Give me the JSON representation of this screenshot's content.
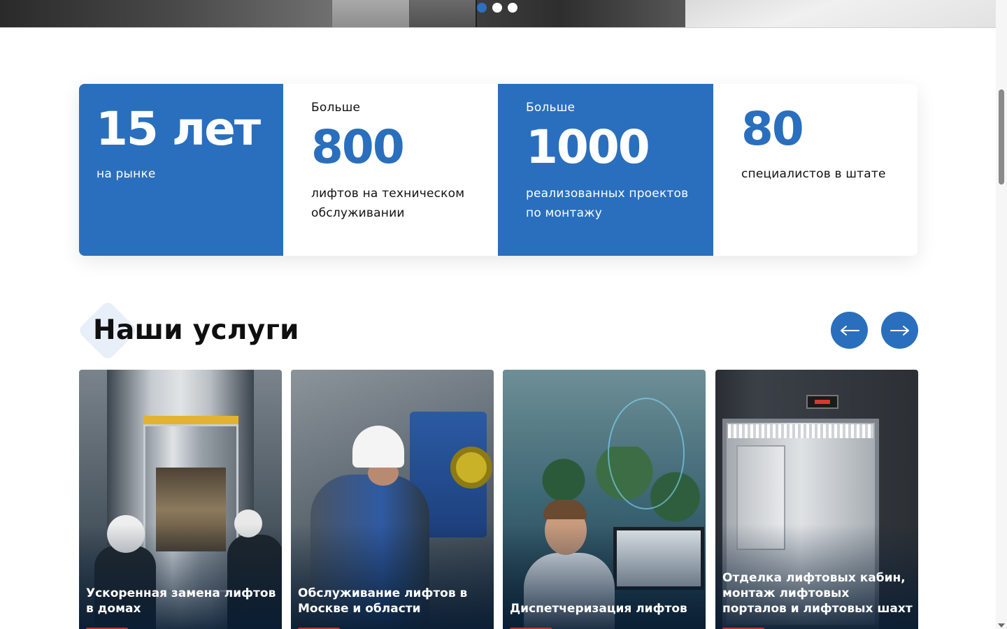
{
  "hero": {
    "slides": 3,
    "active_slide": 1
  },
  "stats": [
    {
      "prefix": "",
      "value": "15 лет",
      "description": "на рынке",
      "style": "blue"
    },
    {
      "prefix": "Больше",
      "value": "800",
      "description": "лифтов на техническом обслуживании",
      "style": "white"
    },
    {
      "prefix": "Больше",
      "value": "1000",
      "description": "реализованных проектов по монтажу",
      "style": "blue"
    },
    {
      "prefix": "",
      "value": "80",
      "description": "специалистов в штате",
      "style": "white"
    }
  ],
  "services": {
    "title": "Наши услуги",
    "prev_icon": "arrow-left-icon",
    "next_icon": "arrow-right-icon",
    "cards": [
      {
        "title": "Ускоренная замена лифтов в домах"
      },
      {
        "title": "Обслуживание лифтов в Москве и области"
      },
      {
        "title": "Диспетчеризация лифтов"
      },
      {
        "title": "Отделка лифтовых кабин, монтаж лифтовых порталов и лифтовых шахт"
      }
    ]
  },
  "colors": {
    "brand_blue": "#2a6fbd",
    "accent_red": "#c8302d",
    "slide_dot_active": "#2d6fc0"
  }
}
